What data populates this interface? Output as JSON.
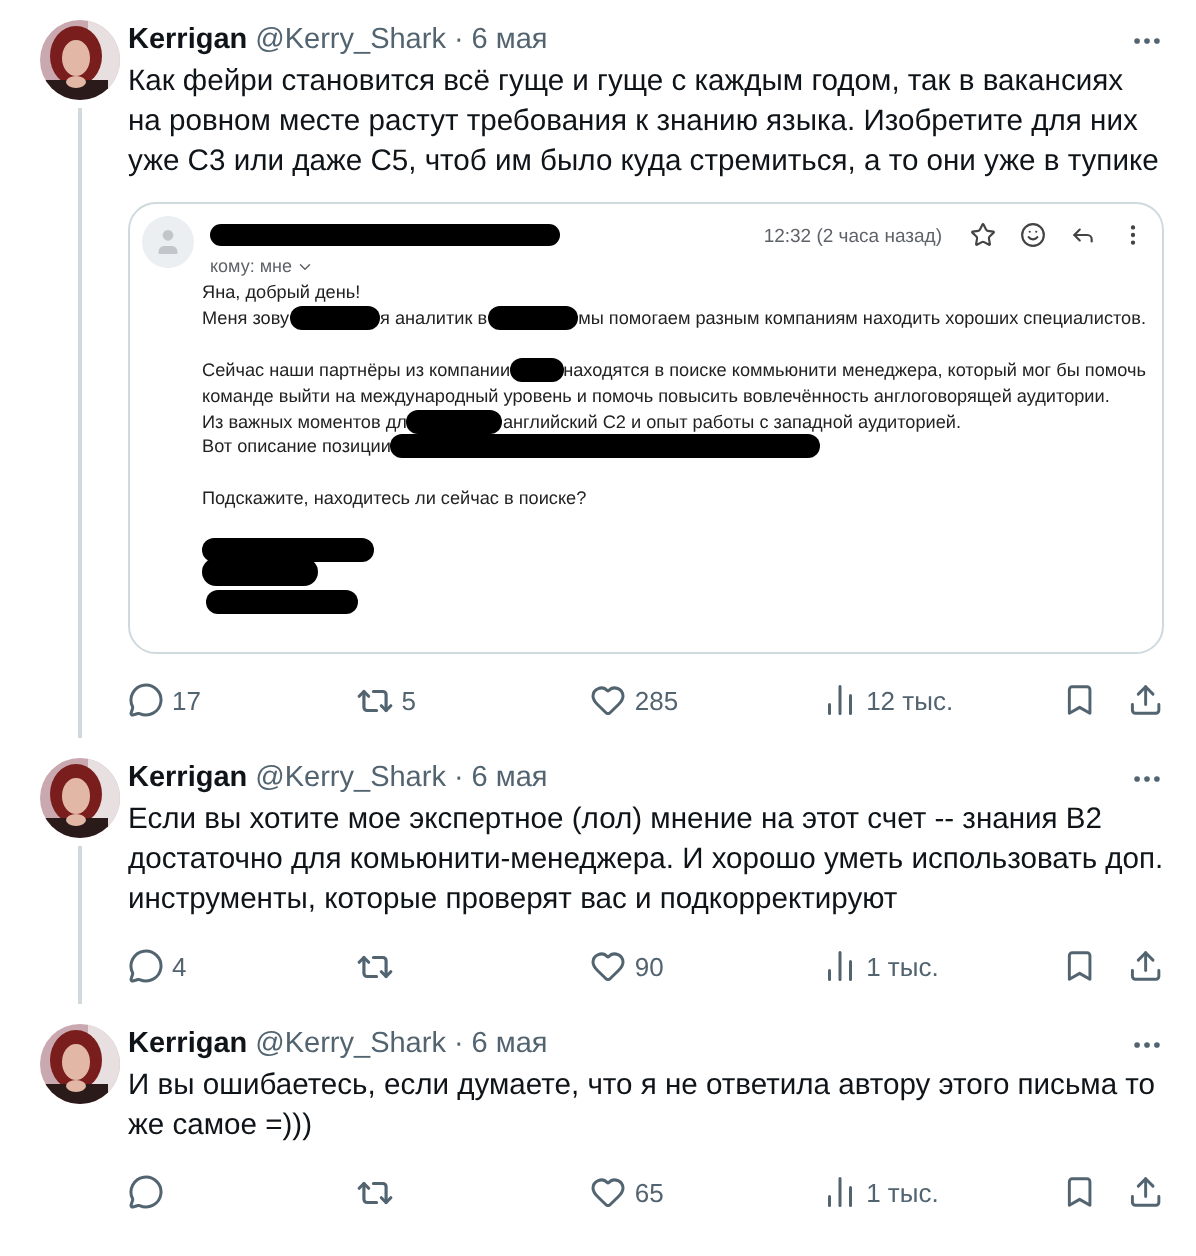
{
  "tweets": [
    {
      "author": "Kerrigan",
      "handle": "@Kerry_Shark",
      "date": "· 6 мая",
      "thread_line": true,
      "text": "Как фейри становится всё гуще и гуще с каждым годом, так в вакансиях на ровном месте растут требования к знанию языка. Изобретите для них уже C3 или даже C5, чтоб им было куда стремиться, а то они уже в тупике",
      "email": {
        "recipient": "кому: мне",
        "time": "12:32 (2 часа назад)",
        "paragraphs": [
          [
            [
              {
                "kind": "text",
                "text": "Яна, добрый день!"
              }
            ],
            [
              {
                "kind": "text",
                "text": "Меня зову"
              },
              {
                "kind": "redacted"
              },
              {
                "kind": "text",
                "text": "я аналитик в"
              },
              {
                "kind": "redacted"
              },
              {
                "kind": "text",
                "text": "мы помогаем разным компаниям находить хороших специалистов."
              }
            ]
          ],
          [
            [
              {
                "kind": "text",
                "text": "Сейчас наши партнёры из компании"
              },
              {
                "kind": "redacted"
              },
              {
                "kind": "text",
                "text": "находятся в поиске коммьюнити менеджера, который мог бы помочь"
              }
            ],
            [
              {
                "kind": "text",
                "text": "команде выйти на международный уровень и помочь повысить вовлечённость англоговорящей аудитории."
              }
            ],
            [
              {
                "kind": "text",
                "text": "Из важных моментов дл"
              },
              {
                "kind": "redacted"
              },
              {
                "kind": "text",
                "text": "английский C2 и опыт работы с западной аудиторией."
              }
            ],
            [
              {
                "kind": "text",
                "text": "Вот описание позиции"
              },
              {
                "kind": "redacted_long"
              }
            ]
          ],
          [
            [
              {
                "kind": "text",
                "text": "Подскажите, находитесь ли сейчас в поиске?"
              }
            ]
          ]
        ]
      },
      "stats": {
        "replies": "17",
        "retweets": "5",
        "likes": "285",
        "views": "12 тыс."
      }
    },
    {
      "author": "Kerrigan",
      "handle": "@Kerry_Shark",
      "date": "· 6 мая",
      "thread_line": true,
      "text": "Если вы хотите мое экспертное (лол) мнение на этот счет -- знания B2 достаточно для комьюнити-менеджера. И хорошо уметь использовать доп. инструменты, которые проверят вас и подкорректируют",
      "stats": {
        "replies": "4",
        "likes": "90",
        "views": "1 тыс."
      }
    },
    {
      "author": "Kerrigan",
      "handle": "@Kerry_Shark",
      "date": "· 6 мая",
      "thread_line": false,
      "text": "И вы ошибаетесь, если думаете, что я не ответила автору этого письма то же самое =)))",
      "stats": {
        "likes": "65",
        "views": "1 тыс."
      }
    }
  ]
}
